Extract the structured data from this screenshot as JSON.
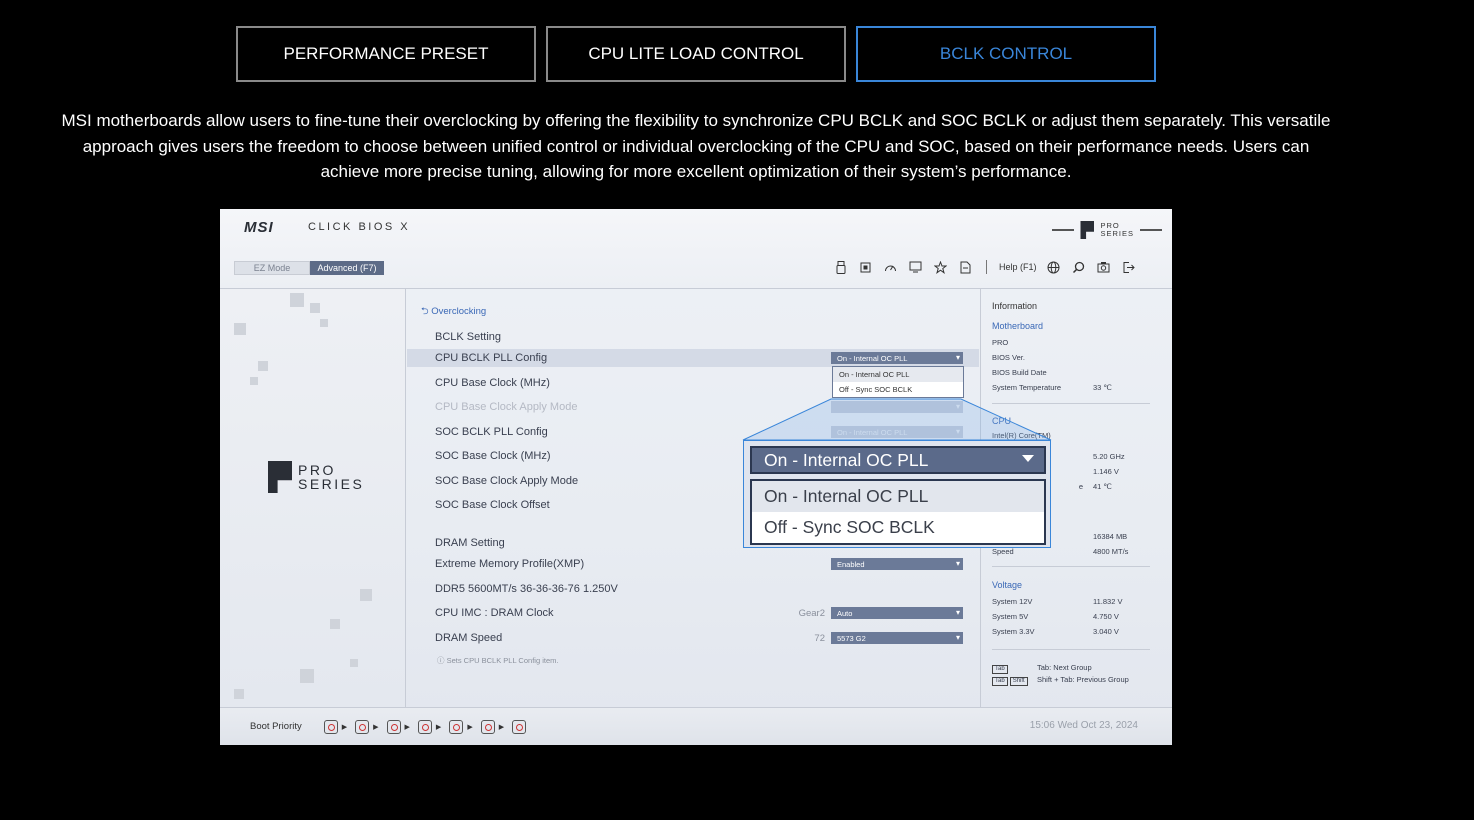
{
  "tabs": [
    {
      "label": "PERFORMANCE PRESET"
    },
    {
      "label": "CPU LITE LOAD CONTROL"
    },
    {
      "label": "BCLK CONTROL",
      "active": true
    }
  ],
  "description": "MSI motherboards allow users to fine-tune their overclocking by offering the flexibility to synchronize CPU BCLK and SOC BCLK or adjust them separately. This versatile approach gives users the freedom to choose between unified control or individual overclocking of the CPU and SOC, based on their performance needs. Users can achieve more precise tuning, allowing for more excellent optimization of their system’s performance.",
  "bios": {
    "brand": "MSI",
    "product": "CLICK BIOS X",
    "series_words": [
      "PRO",
      "SERIES"
    ],
    "modes": {
      "ez": "EZ Mode",
      "advanced": "Advanced (F7)"
    },
    "help": "Help (F1)",
    "breadcrumb": "Overclocking",
    "bclk_heading": "BCLK Setting",
    "settings": [
      {
        "label": "CPU BCLK PLL Config",
        "value": "On - Internal OC PLL"
      },
      {
        "label": "CPU Base Clock (MHz)",
        "value": ""
      },
      {
        "label": "CPU Base Clock Apply Mode",
        "value": ""
      },
      {
        "label": "SOC BCLK PLL Config",
        "value": "On - Internal OC PLL"
      },
      {
        "label": "SOC Base Clock (MHz)",
        "value": ""
      },
      {
        "label": "SOC Base Clock Apply Mode",
        "value": ""
      },
      {
        "label": "SOC Base Clock Offset",
        "value": ""
      }
    ],
    "dropdown_options": [
      "On - Internal OC PLL",
      "Off - Sync SOC BCLK"
    ],
    "dram_heading": "DRAM Setting",
    "dram": [
      {
        "label": "Extreme Memory Profile(XMP)",
        "prefix": "",
        "value": "Enabled"
      },
      {
        "label": "DDR5 5600MT/s 36-36-36-76 1.250V",
        "prefix": "",
        "value": ""
      },
      {
        "label": "CPU IMC : DRAM Clock",
        "prefix": "Gear2",
        "value": "Auto"
      },
      {
        "label": "DRAM Speed",
        "prefix": "72",
        "value": "5573 G2"
      }
    ],
    "hint": "Sets CPU BCLK PLL Config item.",
    "info": {
      "title": "Information",
      "motherboard_heading": "Motherboard",
      "model": "PRO",
      "bios_ver_label": "BIOS Ver.",
      "build_date_label": "BIOS Build Date",
      "temp_label": "System Temperature",
      "temp_value": "33 ℃",
      "cpu_heading": "CPU",
      "cpu_name": "Intel(R) Core(TM)",
      "cpu_freq": "5.20 GHz",
      "cpu_volt": "1.146 V",
      "cpu_temp_suffix": "e",
      "cpu_temp": "41 ℃",
      "mem_size": "16384 MB",
      "mem_speed_label": "Speed",
      "mem_speed": "4800 MT/s",
      "voltage_heading": "Voltage",
      "v12_label": "System 12V",
      "v12": "11.832 V",
      "v5_label": "System 5V",
      "v5": "4.750 V",
      "v33_label": "System 3.3V",
      "v33": "3.040 V",
      "key_tab": "Tab",
      "key_shift": "Shift",
      "tab_next": "Tab: Next Group",
      "tab_prev": "Shift + Tab: Previous Group"
    },
    "boot_label": "Boot Priority",
    "clock": "15:06  Wed Oct 23, 2024"
  },
  "zoom": {
    "selected": "On - Internal OC PLL",
    "options": [
      "On - Internal OC PLL",
      "Off - Sync SOC BCLK"
    ]
  },
  "colors": {
    "accent": "#3a86d9",
    "select_bg": "#5b6a8a"
  }
}
